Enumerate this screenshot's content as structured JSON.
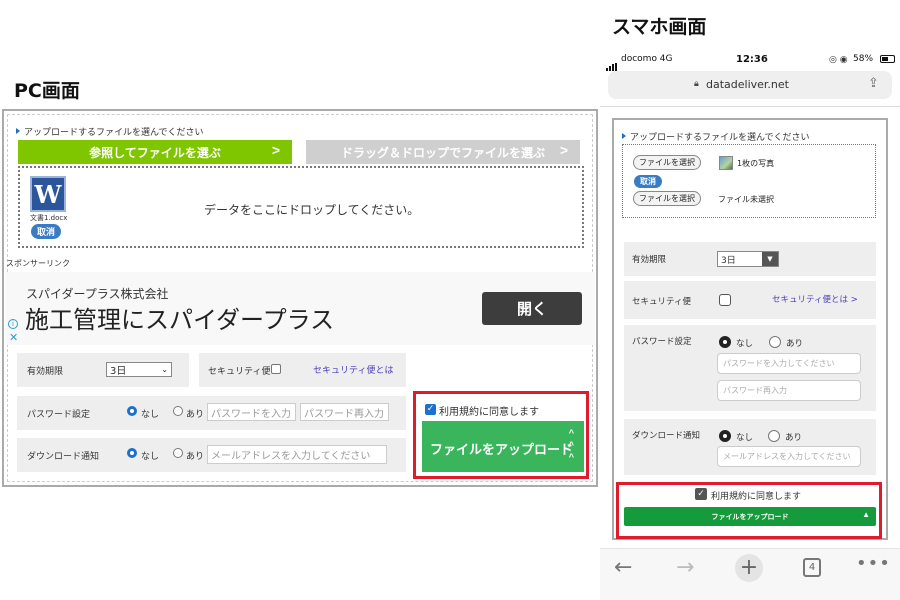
{
  "headings": {
    "pc": "PC画面",
    "smartphone": "スマホ画面"
  },
  "pc": {
    "upload_prompt": "アップロードするファイルを選んでください",
    "browse_button": "参照してファイルを選ぶ",
    "drag_button": "ドラッグ＆ドロップでファイルを選ぶ",
    "button_arrow": ">",
    "drop_text": "データをここにドロップしてください。",
    "file_icon_letter": "W",
    "file_name": "文書1.docx",
    "cancel_label": "取消",
    "sponsor_label": "スポンサーリンク",
    "ad": {
      "company": "スパイダープラス株式会社",
      "headline": "施工管理にスパイダープラス",
      "open_button": "開く",
      "info_icon": "i",
      "close_icon": "✕"
    },
    "expiry": {
      "label": "有効期限",
      "value": "3日"
    },
    "security": {
      "label": "セキュリティ便",
      "link": "セキュリティ便とは"
    },
    "password": {
      "label": "パスワード設定",
      "option_none": "なし",
      "option_yes": "あり",
      "input_placeholder": "パスワードを入力",
      "confirm_placeholder": "パスワード再入力"
    },
    "download_notify": {
      "label": "ダウンロード通知",
      "option_none": "なし",
      "option_yes": "あり",
      "email_placeholder": "メールアドレスを入力してください"
    },
    "agree_label": "利用規約に同意します",
    "upload_button": "ファイルをアップロード"
  },
  "smartphone": {
    "status": {
      "carrier": "docomo 4G",
      "time": "12:36",
      "battery": "58%",
      "battery_level": 0.58
    },
    "url": "datadeliver.net",
    "upload_prompt": "アップロードするファイルを選んでください",
    "choose_file_button": "ファイルを選択",
    "file1_status": "1枚の写真",
    "cancel_label": "取消",
    "file2_status": "ファイル未選択",
    "expiry": {
      "label": "有効期限",
      "value": "3日"
    },
    "security": {
      "label": "セキュリティ便",
      "link": "セキュリティ便とは >"
    },
    "password": {
      "label": "パスワード設定",
      "option_none": "なし",
      "option_yes": "あり",
      "input_placeholder": "パスワードを入力してください",
      "confirm_placeholder": "パスワード再入力"
    },
    "download_notify": {
      "label": "ダウンロード通知",
      "option_none": "なし",
      "option_yes": "あり",
      "email_placeholder": "メールアドレスを入力してください"
    },
    "agree_label": "利用規約に同意します",
    "upload_button": "ファイルをアップロード",
    "toolbar": {
      "tab_count": "4"
    }
  },
  "colors": {
    "highlight_red": "#e01b2e",
    "pc_upload_green": "#3bb55c",
    "sp_upload_green": "#169b3c",
    "browse_green": "#7fc500"
  }
}
